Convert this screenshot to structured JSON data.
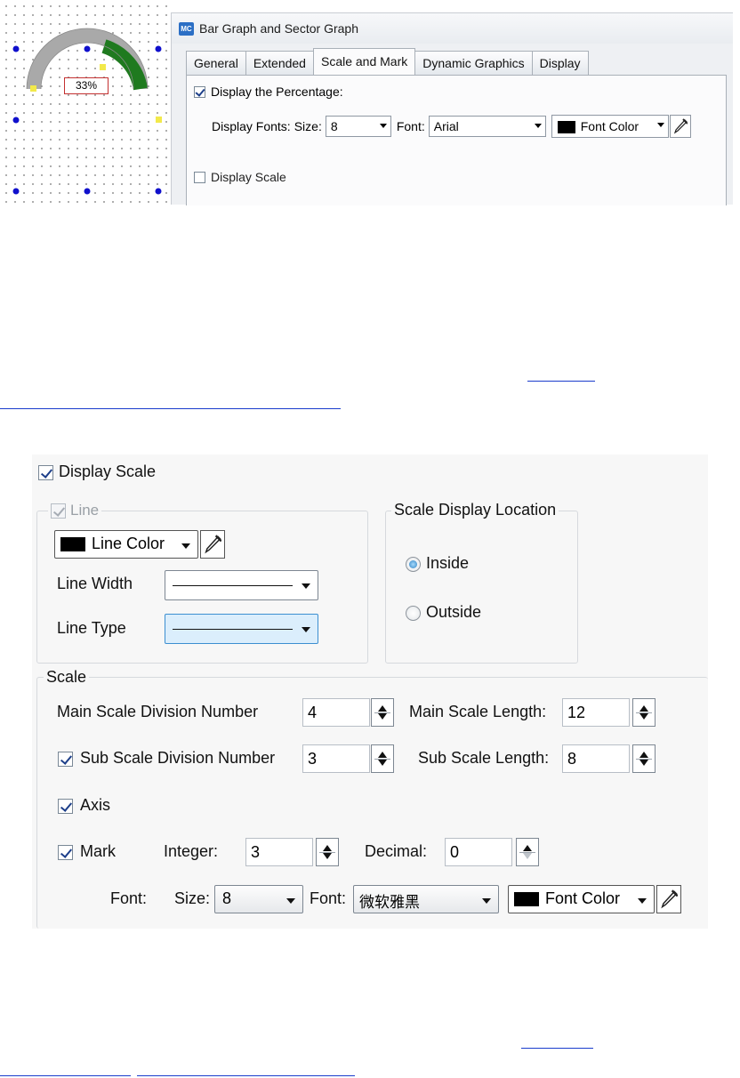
{
  "top": {
    "gauge_label": "33%",
    "dialog": {
      "icon_text": "MC",
      "title": "Bar Graph and Sector Graph",
      "tabs": [
        "General",
        "Extended",
        "Scale and Mark",
        "Dynamic Graphics",
        "Display"
      ],
      "active_tab": "Scale and Mark",
      "display_percentage_label": "Display the Percentage:",
      "display_fonts_label": "Display Fonts:",
      "size_label": "Size:",
      "size_value": "8",
      "font_label": "Font:",
      "font_value": "Arial",
      "font_color_label": "Font Color",
      "display_scale_label": "Display Scale"
    },
    "colors": {
      "gauge_track": "#a9a9a9",
      "gauge_fill": "#1f7a1f",
      "handle": "#1010cc"
    }
  },
  "bottom": {
    "display_scale_label": "Display Scale",
    "line_group": {
      "title": "Line",
      "line_color_label": "Line Color",
      "line_width_label": "Line Width",
      "line_type_label": "Line Type"
    },
    "location_group": {
      "title": "Scale Display Location",
      "inside_label": "Inside",
      "outside_label": "Outside",
      "selected": "Inside"
    },
    "scale_group": {
      "title": "Scale",
      "main_division_label": "Main Scale Division Number",
      "main_division_value": "4",
      "main_length_label": "Main Scale Length:",
      "main_length_value": "12",
      "sub_division_label": "Sub Scale Division Number",
      "sub_division_value": "3",
      "sub_length_label": "Sub Scale Length:",
      "sub_length_value": "8",
      "axis_label": "Axis",
      "mark_label": "Mark",
      "integer_label": "Integer:",
      "integer_value": "3",
      "decimal_label": "Decimal:",
      "decimal_value": "0",
      "font_row_label": "Font:",
      "size_label": "Size:",
      "size_value": "8",
      "font_label": "Font:",
      "font_value": "微软雅黑",
      "font_color_label": "Font Color"
    }
  }
}
